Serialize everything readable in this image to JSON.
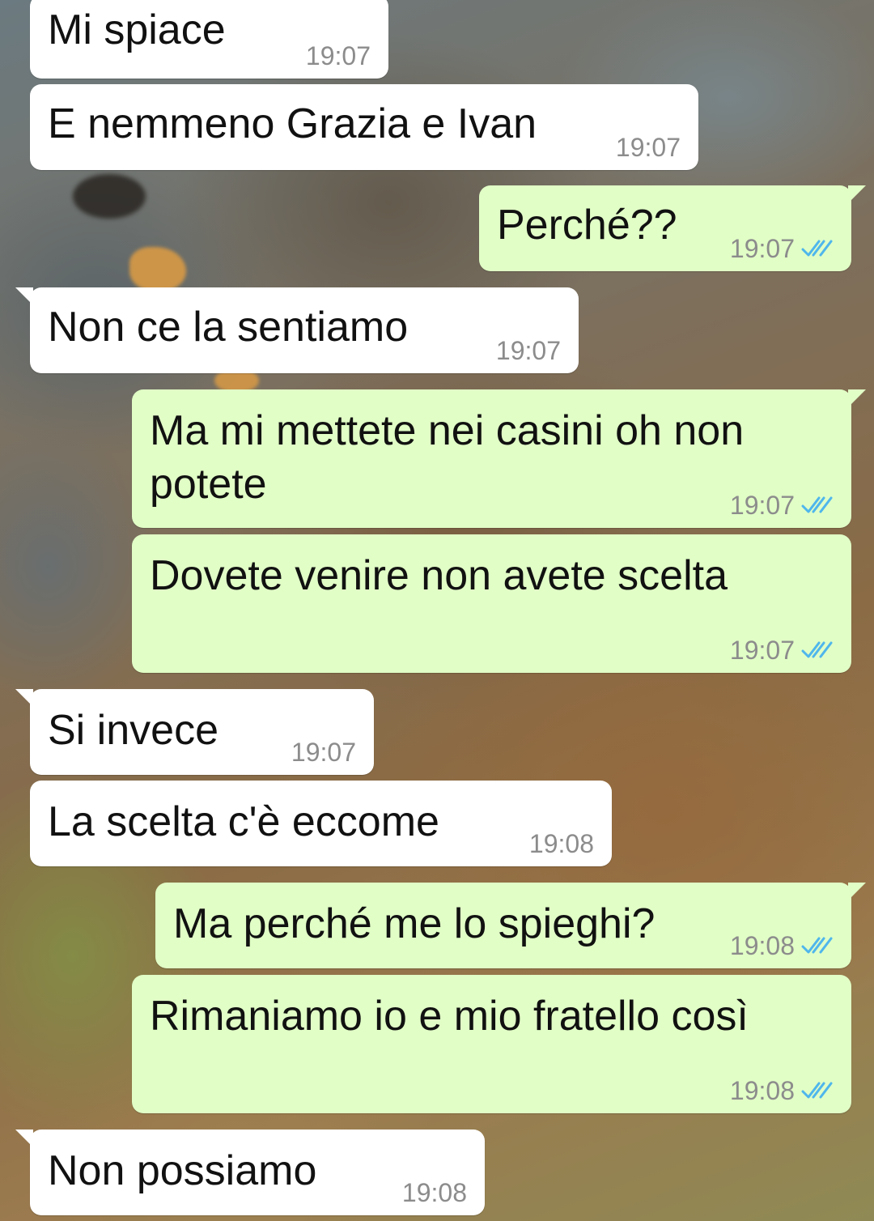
{
  "chat": {
    "messages": [
      {
        "id": 1,
        "direction": "incoming",
        "text": "Mi spiace",
        "time": "19:07"
      },
      {
        "id": 2,
        "direction": "incoming",
        "text": "E nemmeno Grazia e Ivan",
        "time": "19:07"
      },
      {
        "id": 3,
        "direction": "outgoing",
        "text": "Perché??",
        "time": "19:07",
        "status": "read"
      },
      {
        "id": 4,
        "direction": "incoming",
        "text": "Non ce la sentiamo",
        "time": "19:07"
      },
      {
        "id": 5,
        "direction": "outgoing",
        "text": "Ma mi mettete nei casini oh non potete",
        "time": "19:07",
        "status": "read"
      },
      {
        "id": 6,
        "direction": "outgoing",
        "text": "Dovete venire non avete scelta",
        "time": "19:07",
        "status": "read"
      },
      {
        "id": 7,
        "direction": "incoming",
        "text": "Si invece",
        "time": "19:07"
      },
      {
        "id": 8,
        "direction": "incoming",
        "text": "La scelta c'è eccome",
        "time": "19:08"
      },
      {
        "id": 9,
        "direction": "outgoing",
        "text": "Ma perché me lo spieghi?",
        "time": "19:08",
        "status": "read"
      },
      {
        "id": 10,
        "direction": "outgoing",
        "text": "Rimaniamo io e mio fratello così",
        "time": "19:08",
        "status": "read"
      },
      {
        "id": 11,
        "direction": "incoming",
        "text": "Non possiamo",
        "time": "19:08"
      }
    ]
  },
  "colors": {
    "incoming_bubble": "#ffffff",
    "outgoing_bubble": "#e1fec6",
    "read_ticks": "#4fb6ec",
    "timestamp": "#8c8c8c"
  },
  "icons": {
    "read_status": "double-check-icon"
  }
}
